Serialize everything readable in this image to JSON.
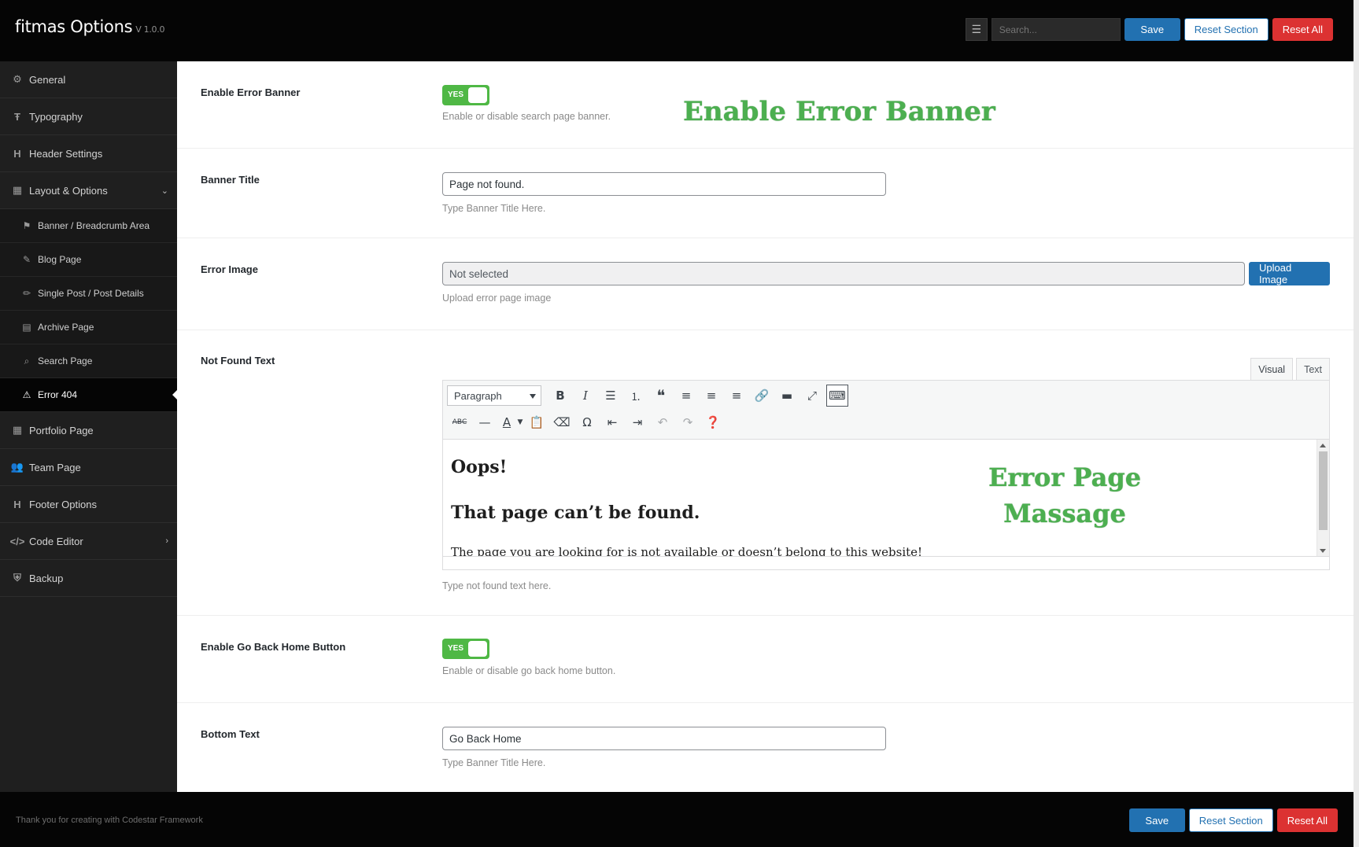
{
  "header": {
    "brand": "fitmas Options",
    "version": "V 1.0.0",
    "search_placeholder": "Search...",
    "save_label": "Save",
    "reset_section_label": "Reset Section",
    "reset_all_label": "Reset All"
  },
  "sidebar": {
    "items": [
      {
        "label": "General",
        "icon": "gears-icon"
      },
      {
        "label": "Typography",
        "icon": "text-height-icon"
      },
      {
        "label": "Header Settings",
        "icon": "heading-icon"
      },
      {
        "label": "Layout & Options",
        "icon": "calculator-icon"
      },
      {
        "label": "Portfolio Page",
        "icon": "grid-icon"
      },
      {
        "label": "Team Page",
        "icon": "users-icon"
      },
      {
        "label": "Footer Options",
        "icon": "heading-icon"
      },
      {
        "label": "Code Editor",
        "icon": "code-icon"
      },
      {
        "label": "Backup",
        "icon": "shield-icon"
      }
    ],
    "subitems": [
      {
        "label": "Banner / Breadcrumb Area",
        "icon": "flag-icon"
      },
      {
        "label": "Blog Page",
        "icon": "edit-icon"
      },
      {
        "label": "Single Post / Post Details",
        "icon": "pencil-icon"
      },
      {
        "label": "Archive Page",
        "icon": "archive-icon"
      },
      {
        "label": "Search Page",
        "icon": "search-icon"
      },
      {
        "label": "Error 404",
        "icon": "warning-icon"
      }
    ]
  },
  "fields": {
    "enable_error_banner": {
      "label": "Enable Error Banner",
      "toggle": "YES",
      "desc": "Enable or disable search page banner.",
      "overlay": "Enable Error Banner"
    },
    "banner_title": {
      "label": "Banner Title",
      "value": "Page not found.",
      "desc": "Type Banner Title Here."
    },
    "error_image": {
      "label": "Error Image",
      "value": "Not selected",
      "button": "Upload Image",
      "desc": "Upload error page image"
    },
    "not_found_text": {
      "label": "Not Found Text",
      "tab_visual": "Visual",
      "tab_text": "Text",
      "format": "Paragraph",
      "heading1": "Oops!",
      "heading2": "That page can’t be found.",
      "paragraph": "The page you are looking for is not available or doesn’t belong to this website!",
      "overlay_line1": "Error Page",
      "overlay_line2": "Massage",
      "desc": "Type not found text here."
    },
    "enable_go_back": {
      "label": "Enable Go Back Home Button",
      "toggle": "YES",
      "desc": "Enable or disable go back home button."
    },
    "bottom_text": {
      "label": "Bottom Text",
      "value": "Go Back Home",
      "desc": "Type Banner Title Here."
    }
  },
  "footer": {
    "credit": "Thank you for creating with Codestar Framework",
    "save_label": "Save",
    "reset_section_label": "Reset Section",
    "reset_all_label": "Reset All"
  },
  "colors": {
    "accent_blue": "#2271b1",
    "danger_red": "#dc3232",
    "toggle_green": "#4fb845",
    "overlay_green": "#4caf50"
  }
}
